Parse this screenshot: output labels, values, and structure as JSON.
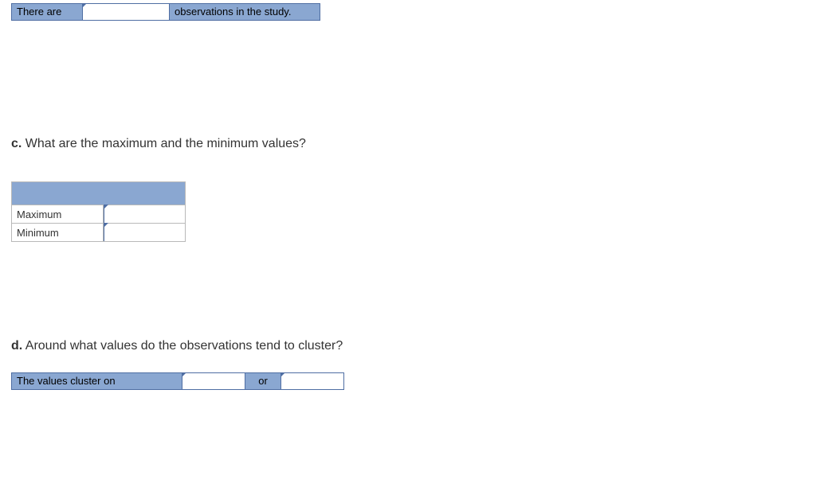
{
  "row_observations": {
    "prefix": "There are",
    "input_value": "",
    "suffix": "observations in the study."
  },
  "question_c": {
    "letter": "c.",
    "text": "What are the maximum and the minimum values?"
  },
  "mm_table": {
    "rows": [
      {
        "label": "Maximum",
        "value": ""
      },
      {
        "label": "Minimum",
        "value": ""
      }
    ]
  },
  "question_d": {
    "letter": "d.",
    "text": "Around what values do the observations tend to cluster?"
  },
  "row_cluster": {
    "prefix": "The values cluster on",
    "input1_value": "",
    "middle": "or",
    "input2_value": ""
  }
}
